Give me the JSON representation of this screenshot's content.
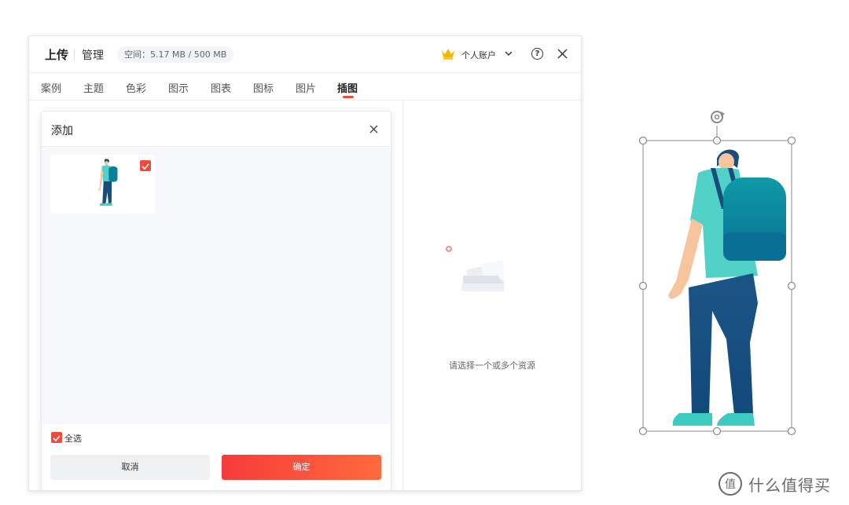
{
  "header": {
    "upload_label": "上传",
    "manage_label": "管理",
    "storage_quota": "空间：5.17 MB / 500 MB",
    "account_label": "个人账户",
    "help_glyph": "?"
  },
  "tabs": [
    {
      "label": "案例"
    },
    {
      "label": "主题"
    },
    {
      "label": "色彩"
    },
    {
      "label": "图示"
    },
    {
      "label": "图表"
    },
    {
      "label": "图标"
    },
    {
      "label": "图片"
    },
    {
      "label": "插图",
      "active": true
    }
  ],
  "dialog": {
    "title": "添加",
    "items": [
      {
        "type": "illustration",
        "subject": "person with backpack",
        "checked": true
      }
    ],
    "select_all_label": "全选",
    "select_all_checked": true,
    "cancel_label": "取消",
    "confirm_label": "确定"
  },
  "preview": {
    "empty_text": "请选择一个或多个资源"
  },
  "watermark": {
    "logo_glyph": "值",
    "text": "什么值得买"
  },
  "colors": {
    "accent_red": "#f04a3c",
    "button_gradient_start": "#f63b3b",
    "button_gradient_end": "#ff6a3c",
    "shirt": "#52d1c8",
    "backpack": "#0b7f9a",
    "pants": "#174e7c",
    "skin": "#f6c49d",
    "shoes": "#3ccbc0",
    "crown": "#f5b800"
  },
  "icons": [
    "crown-icon",
    "chevron-down-icon",
    "help-icon",
    "close-icon",
    "checkbox-checked-icon",
    "rotate-handle-icon",
    "empty-folder-icon"
  ]
}
